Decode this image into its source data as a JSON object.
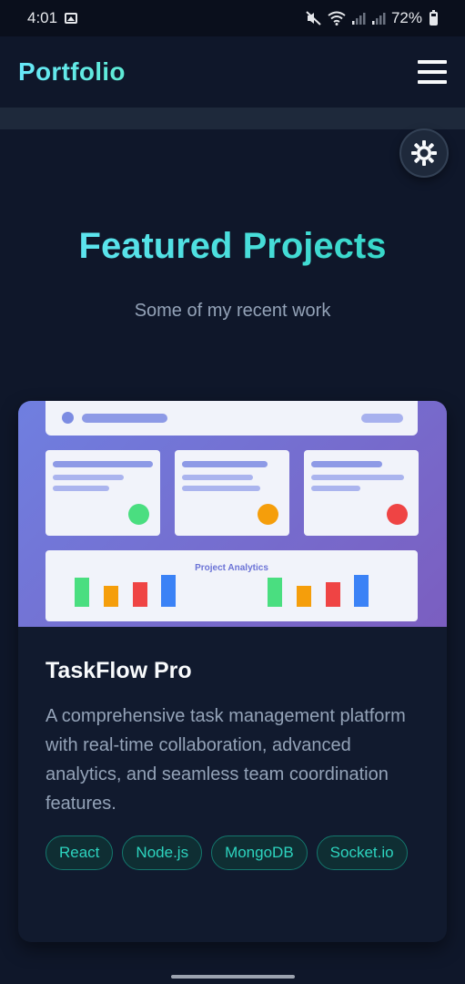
{
  "status_bar": {
    "time": "4:01",
    "battery": "72%"
  },
  "nav": {
    "logo": "Portfolio"
  },
  "section": {
    "title": "Featured Projects",
    "subtitle": "Some of my recent work"
  },
  "project": {
    "preview": {
      "analytics_label": "Project Analytics",
      "status_colors": [
        "#4ade80",
        "#f59e0b",
        "#ef4444"
      ],
      "bar_colors": [
        "#4ade80",
        "#f59e0b",
        "#ef4444",
        "#3b82f6"
      ]
    },
    "title": "TaskFlow Pro",
    "description": "A comprehensive task management platform with real-time collaboration, advanced analytics, and seamless team coordination features.",
    "tags": [
      "React",
      "Node.js",
      "MongoDB",
      "Socket.io"
    ]
  },
  "icons": {
    "menu": "hamburger-menu-icon",
    "theme": "sun-icon"
  },
  "colors": {
    "background": "#0f172a",
    "accent": "#2dd4bf",
    "card": "#111a2e"
  }
}
